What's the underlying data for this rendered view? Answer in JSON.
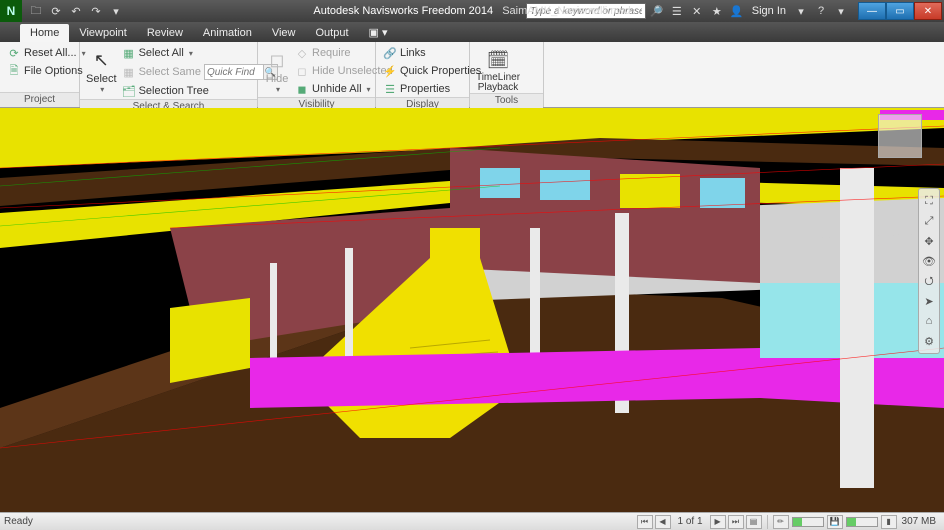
{
  "title": {
    "app": "Autodesk Navisworks Freedom 2014",
    "file": "SaimAMK_Navismalli.nwd",
    "search_placeholder": "Type a keyword or phrase",
    "signin": "Sign In"
  },
  "tabs": {
    "items": [
      "Home",
      "Viewpoint",
      "Review",
      "Animation",
      "View",
      "Output"
    ],
    "active": 0
  },
  "ribbon": {
    "project": {
      "label": "Project",
      "reset_all": "Reset All...",
      "file_options": "File Options"
    },
    "select_search": {
      "label": "Select & Search",
      "select": "Select",
      "select_all": "Select All",
      "select_same": "Select Same",
      "selection_tree": "Selection Tree",
      "quick_find_placeholder": "Quick Find"
    },
    "visibility": {
      "label": "Visibility",
      "hide": "Hide",
      "require": "Require",
      "hide_unselected": "Hide Unselected",
      "unhide_all": "Unhide All"
    },
    "display": {
      "label": "Display",
      "links": "Links",
      "quick_properties": "Quick Properties",
      "properties": "Properties"
    },
    "tools": {
      "label": "Tools",
      "timeliner": "TimeLiner Playback"
    }
  },
  "nav_tools": [
    "⛶",
    "⤢",
    "✥",
    "👁",
    "⭯",
    "➤",
    "⌂",
    "⚙"
  ],
  "status": {
    "ready": "Ready",
    "page": "1 of 1",
    "mem": "307 MB"
  }
}
